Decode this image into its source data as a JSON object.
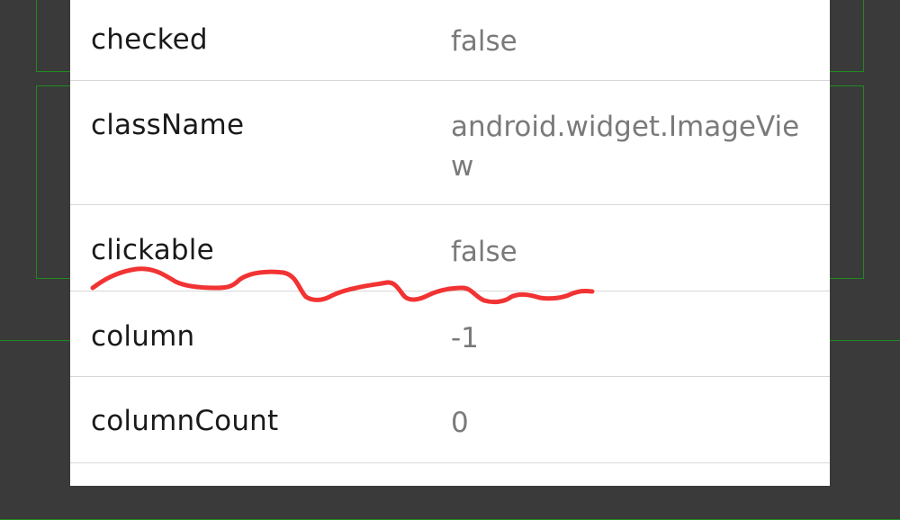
{
  "properties": [
    {
      "name": "checked",
      "value": "false"
    },
    {
      "name": "className",
      "value": "android.widget.ImageView"
    },
    {
      "name": "clickable",
      "value": "false"
    },
    {
      "name": "column",
      "value": "-1"
    },
    {
      "name": "columnCount",
      "value": "0"
    }
  ],
  "colors": {
    "panel_background": "#ffffff",
    "name_text": "#1a1a1a",
    "value_text": "#7a7a7a",
    "divider": "#d8d8d8",
    "backdrop": "#3a3a3a",
    "highlight_outline": "#1f8a1f",
    "annotation_stroke": "#f23333"
  }
}
